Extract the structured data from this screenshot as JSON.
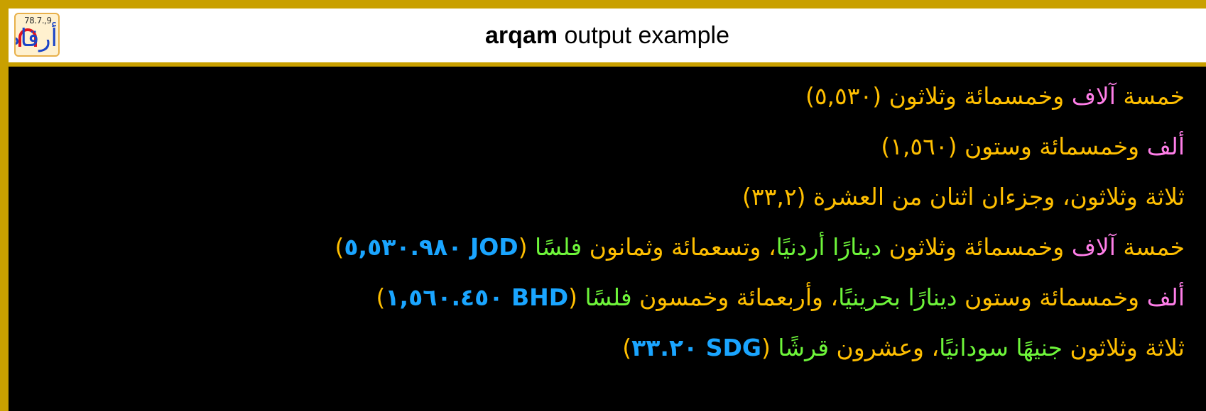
{
  "header": {
    "title_bold": "arqam",
    "title_rest": " output example",
    "logo": {
      "digits": "78.7.,9",
      "word": "أرقام",
      "colors": {
        "word": "#1a44c8",
        "arc": "#e0141e",
        "background": "#fff1cf",
        "border": "#e8b04a"
      }
    }
  },
  "colors": {
    "frame": "#c9a000",
    "panel": "#000000",
    "pink": "#ff7ee8",
    "orange": "#ffbf00",
    "green": "#6ef53a",
    "blue": "#1aa5ff"
  },
  "lines": [
    {
      "segments": [
        {
          "text": "خمسة ",
          "color": "#ffbf00"
        },
        {
          "text": "آلاف ",
          "color": "#ff7ee8"
        },
        {
          "text": "وخمسمائة وثلاثون ",
          "color": "#ffbf00"
        },
        {
          "text": "(",
          "color": "#ffbf00"
        },
        {
          "text": "٥,٥٣٠",
          "color": "#ffbf00"
        },
        {
          "text": ")",
          "color": "#ffbf00"
        }
      ]
    },
    {
      "segments": [
        {
          "text": "ألف ",
          "color": "#ff7ee8"
        },
        {
          "text": "وخمسمائة وستون ",
          "color": "#ffbf00"
        },
        {
          "text": "(",
          "color": "#ffbf00"
        },
        {
          "text": "١,٥٦٠",
          "color": "#ffbf00"
        },
        {
          "text": ")",
          "color": "#ffbf00"
        }
      ]
    },
    {
      "segments": [
        {
          "text": "ثلاثة وثلاثون، وجزءان اثنان من العشرة ",
          "color": "#ffbf00"
        },
        {
          "text": "(",
          "color": "#ffbf00"
        },
        {
          "text": "٣٣,٢",
          "color": "#ffbf00"
        },
        {
          "text": ")",
          "color": "#ffbf00"
        }
      ]
    },
    {
      "segments": [
        {
          "text": "خمسة ",
          "color": "#ffbf00"
        },
        {
          "text": "آلاف ",
          "color": "#ff7ee8"
        },
        {
          "text": "وخمسمائة وثلاثون ",
          "color": "#ffbf00"
        },
        {
          "text": "دينارًا أردنيًا",
          "color": "#6ef53a"
        },
        {
          "text": "، ",
          "color": "#ffbf00"
        },
        {
          "text": "وتسعمائة وثمانون ",
          "color": "#ffbf00"
        },
        {
          "text": "فلسًا ",
          "color": "#6ef53a"
        },
        {
          "text": "(",
          "color": "#ffbf00"
        },
        {
          "text": "٥,٥٣٠.٩٨٠ JOD",
          "color": "#1aa5ff"
        },
        {
          "text": ")",
          "color": "#ffbf00"
        }
      ]
    },
    {
      "segments": [
        {
          "text": "ألف ",
          "color": "#ff7ee8"
        },
        {
          "text": "وخمسمائة وستون ",
          "color": "#ffbf00"
        },
        {
          "text": "دينارًا بحرينيًا",
          "color": "#6ef53a"
        },
        {
          "text": "، ",
          "color": "#ffbf00"
        },
        {
          "text": "وأربعمائة وخمسون ",
          "color": "#ffbf00"
        },
        {
          "text": "فلسًا ",
          "color": "#6ef53a"
        },
        {
          "text": "(",
          "color": "#ffbf00"
        },
        {
          "text": "١,٥٦٠.٤٥٠ BHD",
          "color": "#1aa5ff"
        },
        {
          "text": ")",
          "color": "#ffbf00"
        }
      ]
    },
    {
      "segments": [
        {
          "text": "ثلاثة وثلاثون ",
          "color": "#ffbf00"
        },
        {
          "text": "جنيهًا سودانيًا",
          "color": "#6ef53a"
        },
        {
          "text": "، ",
          "color": "#ffbf00"
        },
        {
          "text": "وعشرون ",
          "color": "#ffbf00"
        },
        {
          "text": "قرشًا ",
          "color": "#6ef53a"
        },
        {
          "text": "(",
          "color": "#ffbf00"
        },
        {
          "text": "٣٣.٢٠ SDG",
          "color": "#1aa5ff"
        },
        {
          "text": ")",
          "color": "#ffbf00"
        }
      ]
    }
  ]
}
